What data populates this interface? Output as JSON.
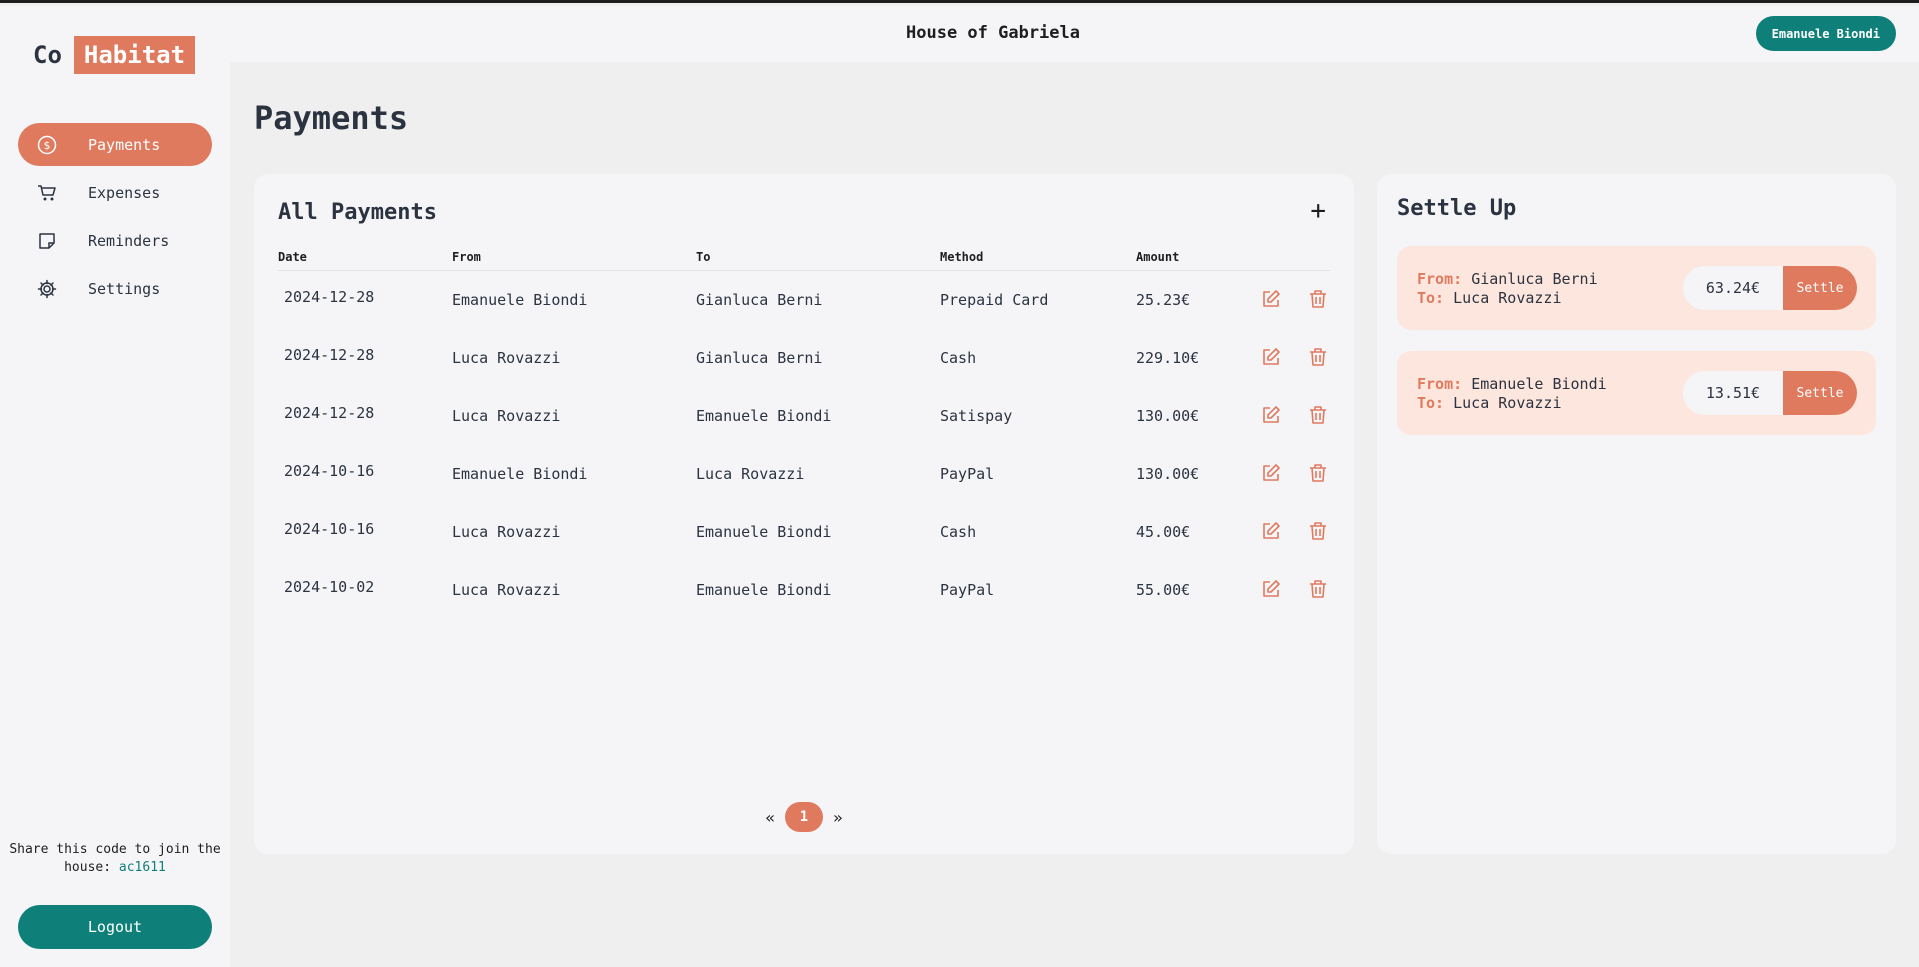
{
  "logo": {
    "part1": "Co",
    "part2": "Habitat"
  },
  "header": {
    "house_title": "House of Gabriela",
    "user_name": "Emanuele Biondi"
  },
  "nav": {
    "items": [
      {
        "label": "Payments",
        "icon": "dollar-circle-icon",
        "active": true
      },
      {
        "label": "Expenses",
        "icon": "cart-icon",
        "active": false
      },
      {
        "label": "Reminders",
        "icon": "sticky-note-icon",
        "active": false
      },
      {
        "label": "Settings",
        "icon": "gear-icon",
        "active": false
      }
    ]
  },
  "share": {
    "text": "Share this code to join the house:",
    "code": "ac1611"
  },
  "logout_label": "Logout",
  "page_title": "Payments",
  "payments": {
    "title": "All Payments",
    "add_label": "+",
    "columns": [
      "Date",
      "From",
      "To",
      "Method",
      "Amount"
    ],
    "rows": [
      {
        "date": "2024-12-28",
        "from": "Emanuele Biondi",
        "to": "Gianluca Berni",
        "method": "Prepaid Card",
        "amount": "25.23€"
      },
      {
        "date": "2024-12-28",
        "from": "Luca Rovazzi",
        "to": "Gianluca Berni",
        "method": "Cash",
        "amount": "229.10€"
      },
      {
        "date": "2024-12-28",
        "from": "Luca Rovazzi",
        "to": "Emanuele Biondi",
        "method": "Satispay",
        "amount": "130.00€"
      },
      {
        "date": "2024-10-16",
        "from": "Emanuele Biondi",
        "to": "Luca Rovazzi",
        "method": "PayPal",
        "amount": "130.00€"
      },
      {
        "date": "2024-10-16",
        "from": "Luca Rovazzi",
        "to": "Emanuele Biondi",
        "method": "Cash",
        "amount": "45.00€"
      },
      {
        "date": "2024-10-02",
        "from": "Luca Rovazzi",
        "to": "Emanuele Biondi",
        "method": "PayPal",
        "amount": "55.00€"
      }
    ],
    "pagination": {
      "prev": "«",
      "current": "1",
      "next": "»"
    }
  },
  "settle": {
    "title": "Settle Up",
    "from_label": "From:",
    "to_label": "To:",
    "button_label": "Settle",
    "items": [
      {
        "from": "Gianluca Berni",
        "to": "Luca Rovazzi",
        "amount": "63.24€"
      },
      {
        "from": "Emanuele Biondi",
        "to": "Luca Rovazzi",
        "amount": "13.51€"
      }
    ]
  },
  "colors": {
    "accent": "#e07a5f",
    "teal": "#0f7f7a",
    "settle_bg": "#fde6de"
  }
}
